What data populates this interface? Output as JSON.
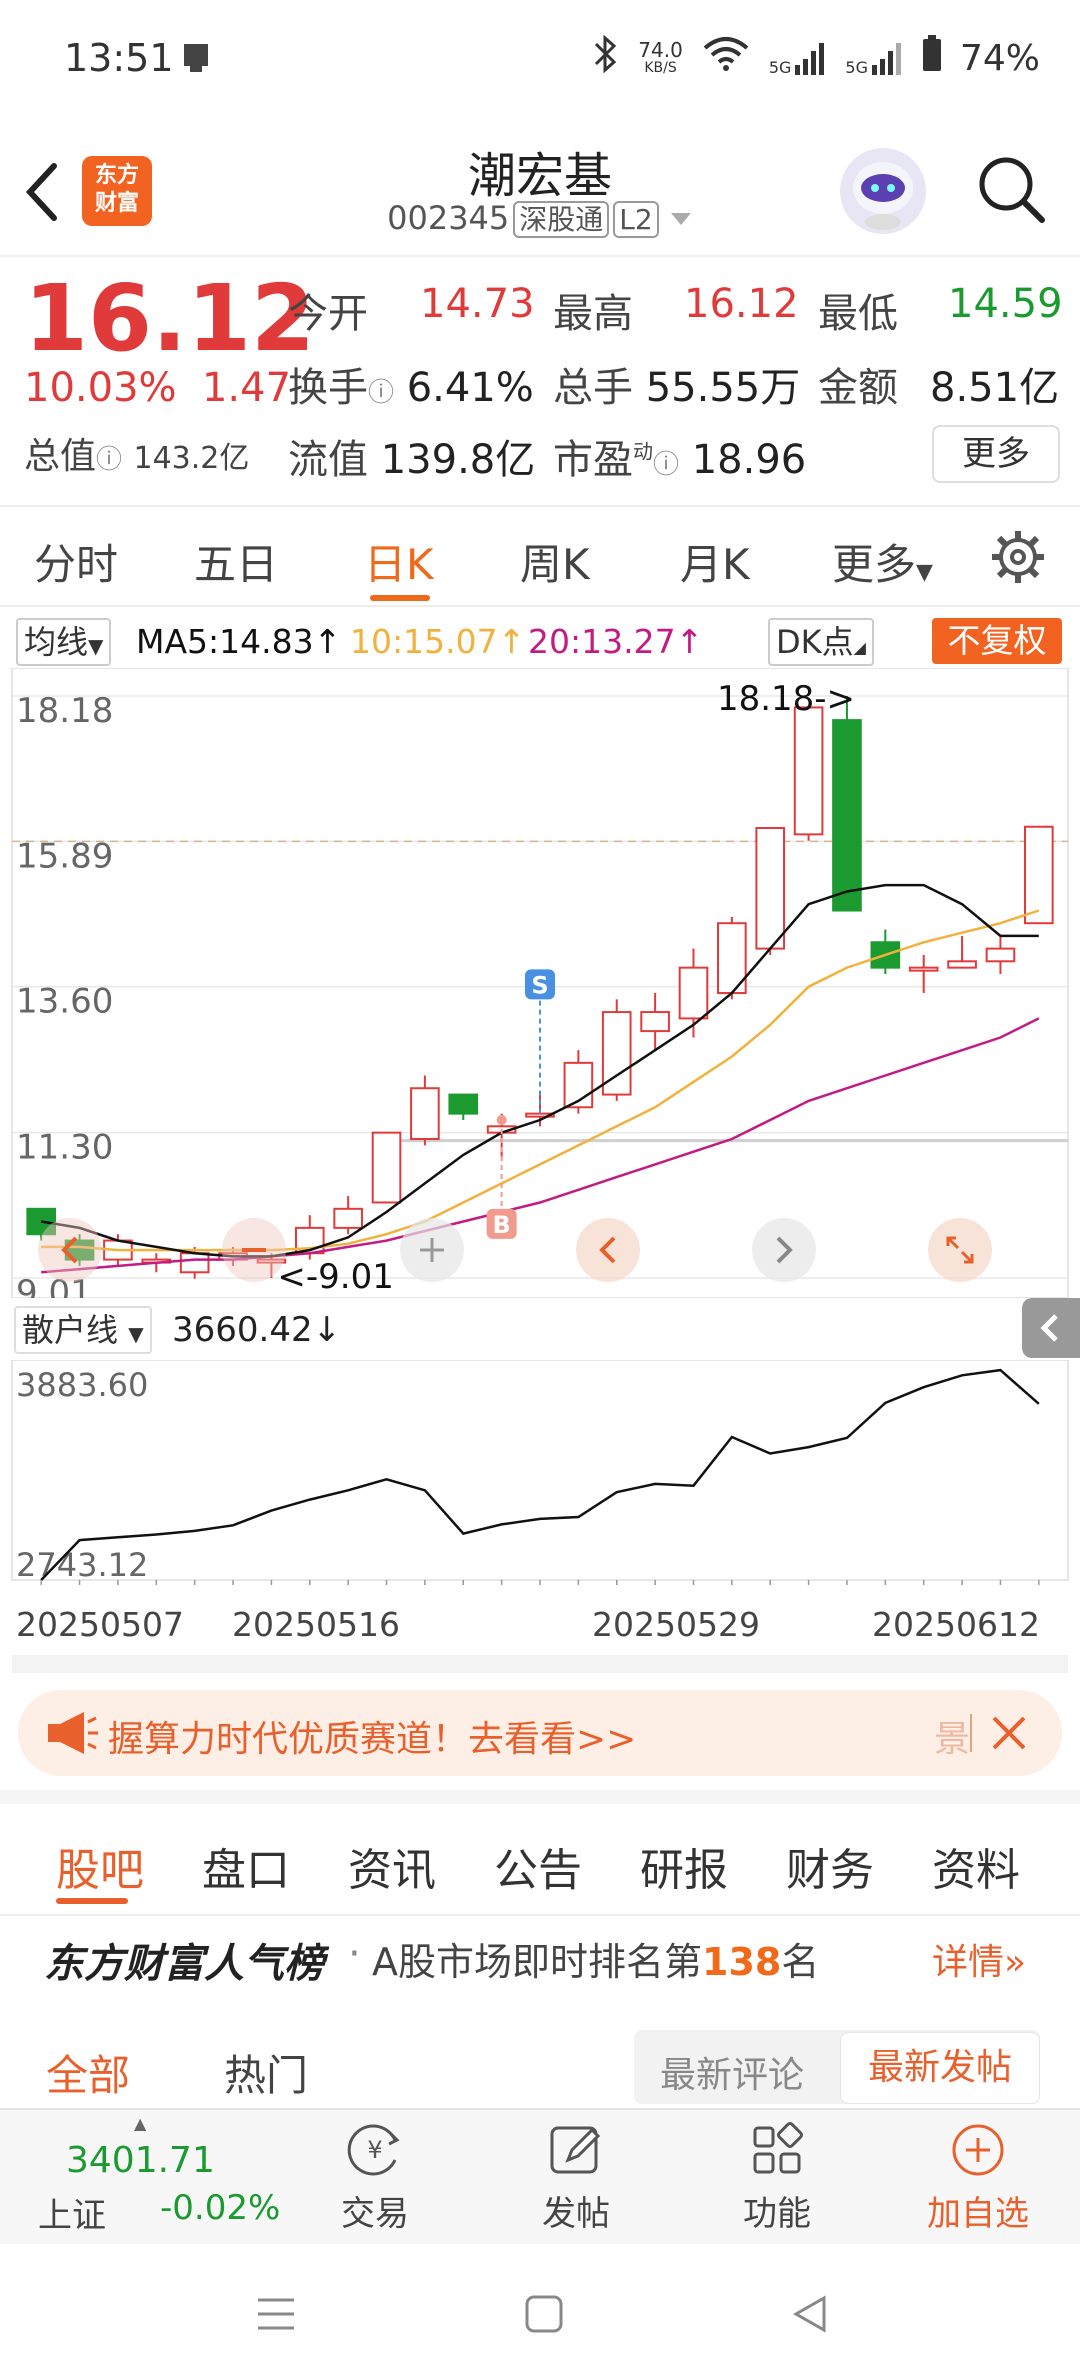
{
  "status_bar": {
    "time": "13:51",
    "net_speed_top": "74.0",
    "net_speed_unit": "KB/S",
    "signal1": "5G",
    "signal2": "5G",
    "battery": "74%"
  },
  "header": {
    "logo_line1": "东方",
    "logo_line2": "财富",
    "stock_name": "潮宏基",
    "stock_code": "002345",
    "tag_connect": "深股通",
    "tag_level": "L2"
  },
  "quote": {
    "price": "16.12",
    "change_pct": "10.03%",
    "change_amt": "1.47",
    "open_label": "今开",
    "open_value": "14.73",
    "high_label": "最高",
    "high_value": "16.12",
    "low_label": "最低",
    "low_value": "14.59",
    "turnover_label": "换手",
    "turnover_value": "6.41%",
    "volume_label": "总手",
    "volume_value": "55.55万",
    "amount_label": "金额",
    "amount_value": "8.51亿",
    "mcap_label": "总值",
    "mcap_value": "143.2亿",
    "float_label": "流值",
    "float_value": "139.8亿",
    "pe_label": "市盈",
    "pe_sup": "动",
    "pe_value": "18.96",
    "more_label": "更多"
  },
  "period_tabs": [
    "分时",
    "五日",
    "日K",
    "周K",
    "月K",
    "更多"
  ],
  "ma_row": {
    "selector": "均线",
    "ma5": "MA5:14.83↑",
    "ma10": "10:15.07↑",
    "ma20": "20:13.27↑",
    "dk_label": "DK点",
    "fq_label": "不复权"
  },
  "colors": {
    "up": "#e03a3a",
    "down": "#1a9a2f",
    "accent": "#f06a1a",
    "ma5": "#111111",
    "ma10": "#f0b23c",
    "ma20": "#c21b83"
  },
  "chart_data": {
    "type": "candlestick",
    "y_ticks": [
      "18.18",
      "15.89",
      "13.60",
      "11.30",
      "9.01"
    ],
    "ylim": [
      9.01,
      18.18
    ],
    "high_annotation": "18.18->",
    "low_annotation": "<-9.01",
    "last_close_ref": 15.89,
    "signal_labels": {
      "sell": "S",
      "buy": "B"
    },
    "candles": [
      {
        "o": 10.1,
        "c": 9.7,
        "h": 10.1,
        "l": 9.6
      },
      {
        "o": 9.6,
        "c": 9.3,
        "h": 9.7,
        "l": 9.2
      },
      {
        "o": 9.3,
        "c": 9.6,
        "h": 9.7,
        "l": 9.2
      },
      {
        "o": 9.3,
        "c": 9.3,
        "h": 9.4,
        "l": 9.1
      },
      {
        "o": 9.1,
        "c": 9.4,
        "h": 9.5,
        "l": 9.0
      },
      {
        "o": 9.3,
        "c": 9.4,
        "h": 9.5,
        "l": 9.2
      },
      {
        "o": 9.3,
        "c": 9.3,
        "h": 9.4,
        "l": 9.01
      },
      {
        "o": 9.4,
        "c": 9.8,
        "h": 10.0,
        "l": 9.3
      },
      {
        "o": 9.8,
        "c": 10.1,
        "h": 10.3,
        "l": 9.7
      },
      {
        "o": 10.2,
        "c": 11.3,
        "h": 11.3,
        "l": 10.2
      },
      {
        "o": 11.2,
        "c": 12.0,
        "h": 12.2,
        "l": 11.1
      },
      {
        "o": 11.9,
        "c": 11.6,
        "h": 11.9,
        "l": 11.5
      },
      {
        "o": 11.3,
        "c": 11.4,
        "h": 11.6,
        "l": 10.9
      },
      {
        "o": 11.6,
        "c": 11.6,
        "h": 11.9,
        "l": 11.4
      },
      {
        "o": 11.7,
        "c": 12.4,
        "h": 12.6,
        "l": 11.6
      },
      {
        "o": 11.9,
        "c": 13.2,
        "h": 13.4,
        "l": 11.8
      },
      {
        "o": 12.9,
        "c": 13.2,
        "h": 13.5,
        "l": 12.6
      },
      {
        "o": 13.1,
        "c": 13.9,
        "h": 14.2,
        "l": 12.8
      },
      {
        "o": 13.5,
        "c": 14.6,
        "h": 14.7,
        "l": 13.4
      },
      {
        "o": 14.2,
        "c": 16.1,
        "h": 16.1,
        "l": 14.1
      },
      {
        "o": 16.0,
        "c": 18.0,
        "h": 18.0,
        "l": 15.9
      },
      {
        "o": 17.8,
        "c": 14.8,
        "h": 18.18,
        "l": 14.8
      },
      {
        "o": 14.3,
        "c": 13.9,
        "h": 14.5,
        "l": 13.8
      },
      {
        "o": 13.9,
        "c": 13.9,
        "h": 14.1,
        "l": 13.5
      },
      {
        "o": 13.9,
        "c": 14.0,
        "h": 14.4,
        "l": 13.9
      },
      {
        "o": 14.0,
        "c": 14.2,
        "h": 14.4,
        "l": 13.8
      },
      {
        "o": 14.6,
        "c": 16.12,
        "h": 16.12,
        "l": 14.59
      }
    ],
    "ma5": [
      9.9,
      9.8,
      9.6,
      9.5,
      9.4,
      9.35,
      9.35,
      9.45,
      9.65,
      10.05,
      10.5,
      10.95,
      11.3,
      11.5,
      11.8,
      12.2,
      12.6,
      13.0,
      13.5,
      14.2,
      14.9,
      15.1,
      15.2,
      15.2,
      14.9,
      14.4,
      14.4
    ],
    "ma10": [
      9.5,
      9.5,
      9.45,
      9.45,
      9.45,
      9.45,
      9.45,
      9.48,
      9.55,
      9.7,
      9.9,
      10.2,
      10.5,
      10.8,
      11.1,
      11.4,
      11.7,
      12.1,
      12.5,
      13.0,
      13.6,
      13.9,
      14.1,
      14.3,
      14.45,
      14.6,
      14.8
    ],
    "ma20": [
      9.1,
      9.15,
      9.2,
      9.25,
      9.3,
      9.3,
      9.35,
      9.4,
      9.5,
      9.6,
      9.75,
      9.9,
      10.05,
      10.2,
      10.4,
      10.6,
      10.8,
      11.0,
      11.2,
      11.5,
      11.8,
      12.0,
      12.2,
      12.4,
      12.6,
      12.8,
      13.1
    ]
  },
  "sub_indicator": {
    "selector": "散户线",
    "value": "3660.42↓",
    "max_label": "3883.60",
    "min_label": "2743.12",
    "ylim": [
      2743.12,
      3883.6
    ],
    "series": [
      2743,
      2960,
      2975,
      2990,
      3010,
      3040,
      3120,
      3180,
      3230,
      3290,
      3230,
      2995,
      3045,
      3075,
      3085,
      3220,
      3265,
      3255,
      3520,
      3430,
      3465,
      3515,
      3705,
      3790,
      3855,
      3883,
      3700
    ]
  },
  "dates": [
    "20250507",
    "20250516",
    "20250529",
    "20250612"
  ],
  "banner": {
    "text": "握算力时代优质赛道！去看看>>",
    "edge_char": "景"
  },
  "news_tabs": [
    "股吧",
    "盘口",
    "资讯",
    "公告",
    "研报",
    "财务",
    "资料"
  ],
  "rank": {
    "brand": "东方财富人气榜",
    "dot": "·",
    "text_before": "A股市场即时排名第",
    "rank_number": "138",
    "text_after": "名",
    "detail": "详情"
  },
  "filters": {
    "all": "全部",
    "hot": "热门",
    "latest_comments": "最新评论",
    "latest_posts": "最新发帖"
  },
  "bottom_nav": {
    "index_value": "3401.71",
    "index_name": "上证",
    "index_change": "-0.02%",
    "trade": "交易",
    "post": "发帖",
    "functions": "功能",
    "add_watch": "加自选"
  }
}
